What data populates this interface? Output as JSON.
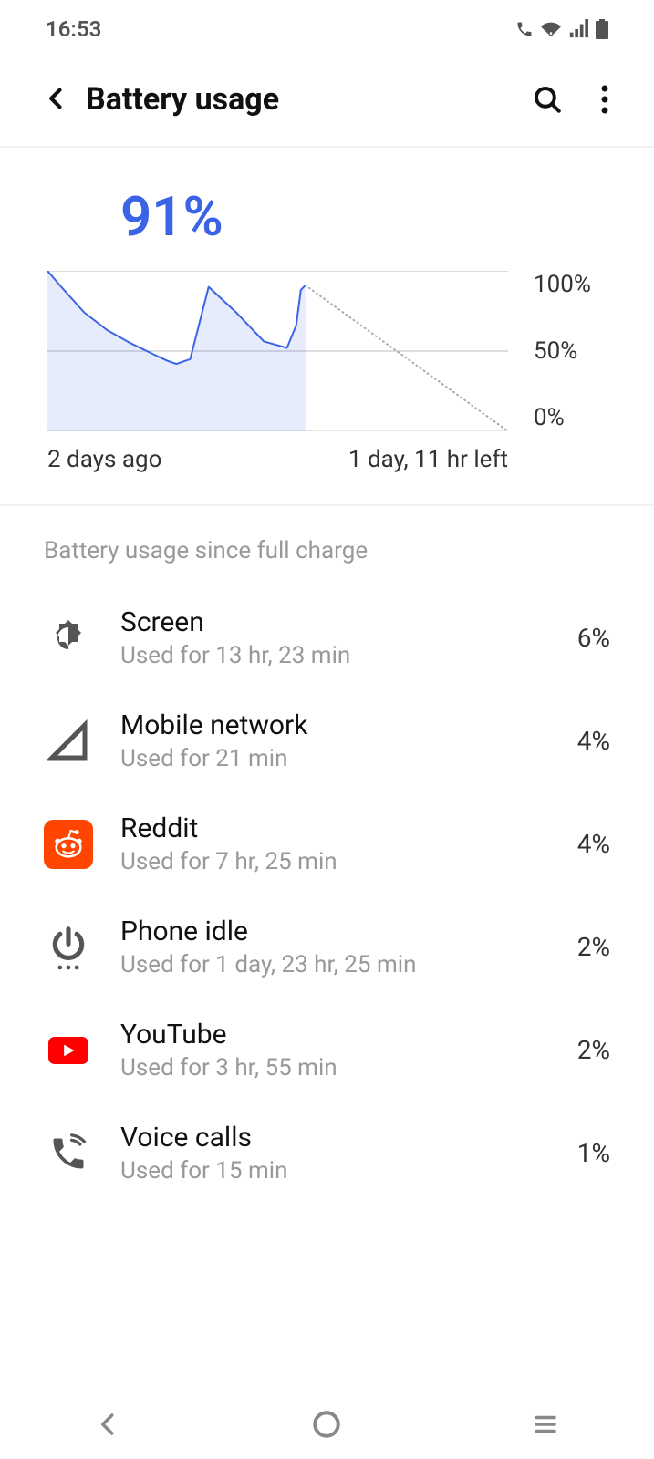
{
  "status": {
    "time": "16:53"
  },
  "header": {
    "title": "Battery usage"
  },
  "battery": {
    "percent": "91%"
  },
  "chart_data": {
    "type": "line",
    "title": "",
    "xlabel": "",
    "ylabel": "",
    "ylim": [
      0,
      100
    ],
    "y_ticks": [
      "100%",
      "50%",
      "0%"
    ],
    "x_annotations": [
      "2 days ago",
      "1 day, 11 hr left"
    ],
    "series": [
      {
        "name": "battery",
        "style": "solid",
        "x": [
          0,
          3,
          8,
          13,
          18,
          23,
          26,
          28,
          29,
          31,
          35,
          41,
          47,
          52,
          54,
          55,
          56
        ],
        "y": [
          100,
          90,
          74,
          63,
          55,
          48,
          44,
          42,
          43,
          45,
          90,
          74,
          56,
          52,
          66,
          88,
          91
        ]
      },
      {
        "name": "forecast",
        "style": "dotted",
        "x": [
          56,
          100
        ],
        "y": [
          91,
          0
        ]
      }
    ]
  },
  "section": {
    "header": "Battery usage since full charge"
  },
  "items": [
    {
      "icon": "brightness",
      "name": "Screen",
      "sub": "Used for 13 hr, 23 min",
      "pct": "6%",
      "color": "#555"
    },
    {
      "icon": "signal",
      "name": "Mobile network",
      "sub": "Used for 21 min",
      "pct": "4%",
      "color": "#555"
    },
    {
      "icon": "reddit",
      "name": "Reddit",
      "sub": "Used for 7 hr, 25 min",
      "pct": "4%",
      "color": "#ff4500"
    },
    {
      "icon": "power",
      "name": "Phone idle",
      "sub": "Used for 1 day, 23 hr, 25 min",
      "pct": "2%",
      "color": "#555"
    },
    {
      "icon": "youtube",
      "name": "YouTube",
      "sub": "Used for 3 hr, 55 min",
      "pct": "2%",
      "color": "#ff0000"
    },
    {
      "icon": "phone",
      "name": "Voice calls",
      "sub": "Used for 15 min",
      "pct": "1%",
      "color": "#555"
    }
  ]
}
